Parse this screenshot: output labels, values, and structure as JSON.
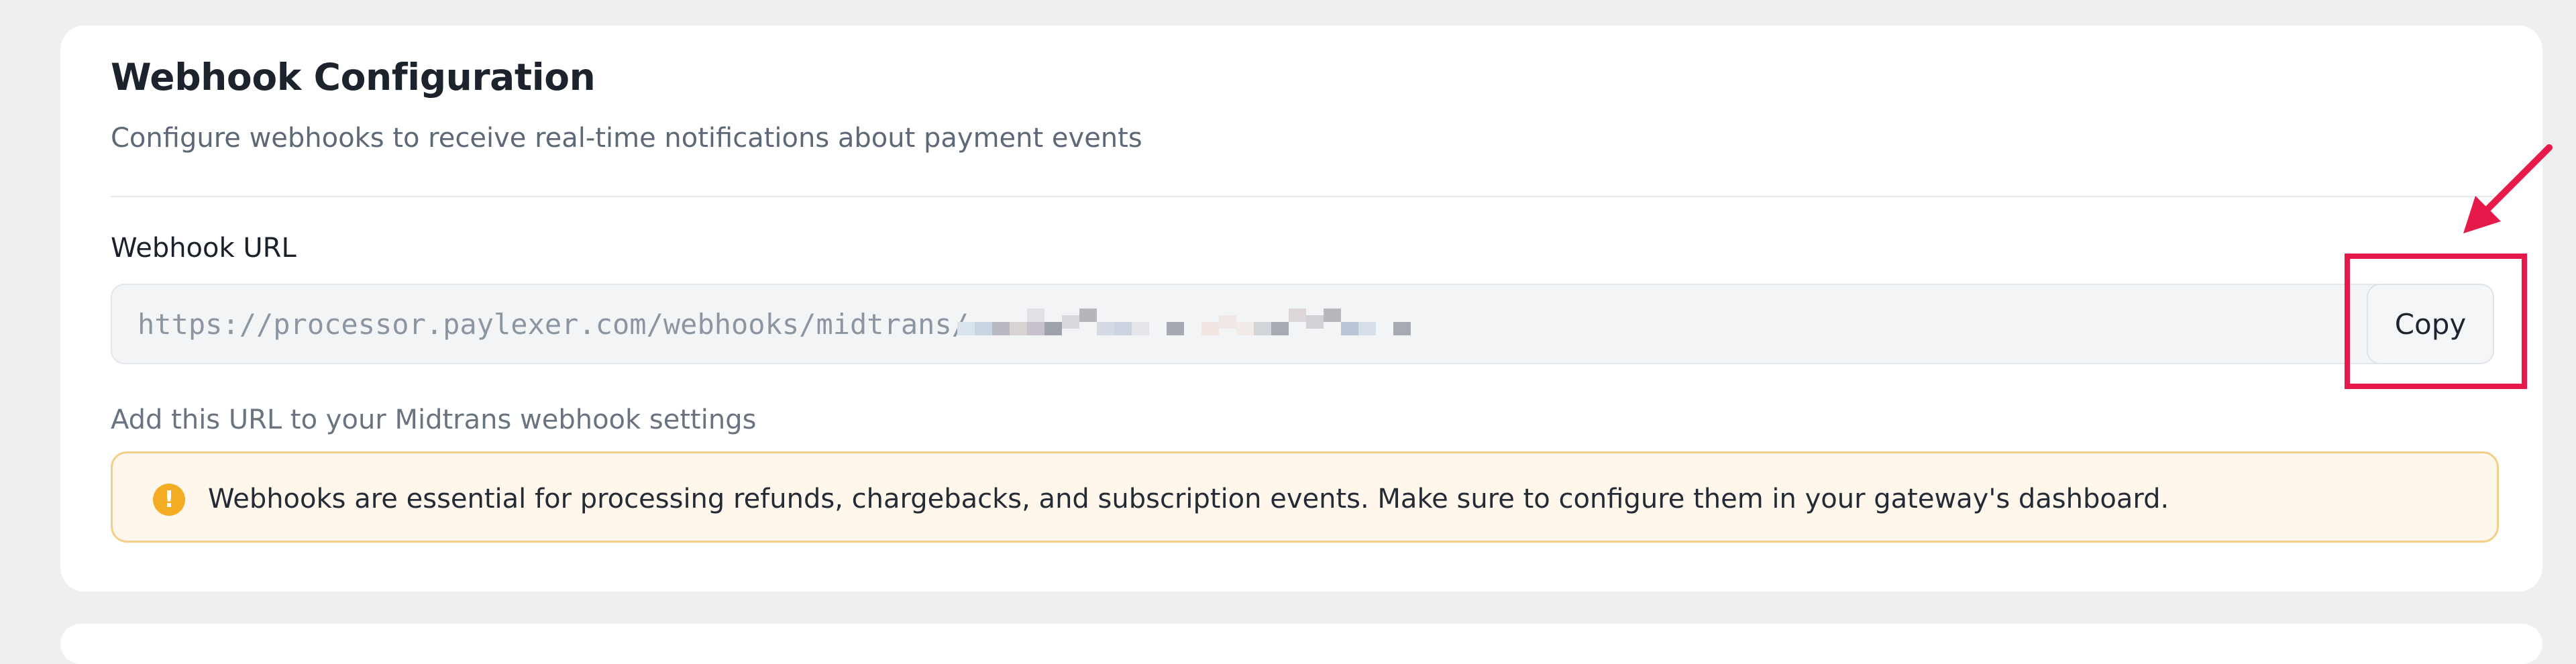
{
  "webhook": {
    "title": "Webhook Configuration",
    "subtitle": "Configure webhooks to receive real-time notifications about payment events",
    "field_label": "Webhook URL",
    "url_value": "https://processor.paylexer.com/webhooks/midtrans/",
    "copy_label": "Copy",
    "helper_text": "Add this URL to your Midtrans webhook settings",
    "notice_icon": "!",
    "notice_text": "Webhooks are essential for processing refunds, chargebacks, and subscription events. Make sure to configure them in your gateway's dashboard."
  },
  "icons": {
    "notice": "warning-icon"
  },
  "colors": {
    "highlight": "#e5194a",
    "warning": "#f3ac24",
    "notice_background": "#fff6ec"
  }
}
